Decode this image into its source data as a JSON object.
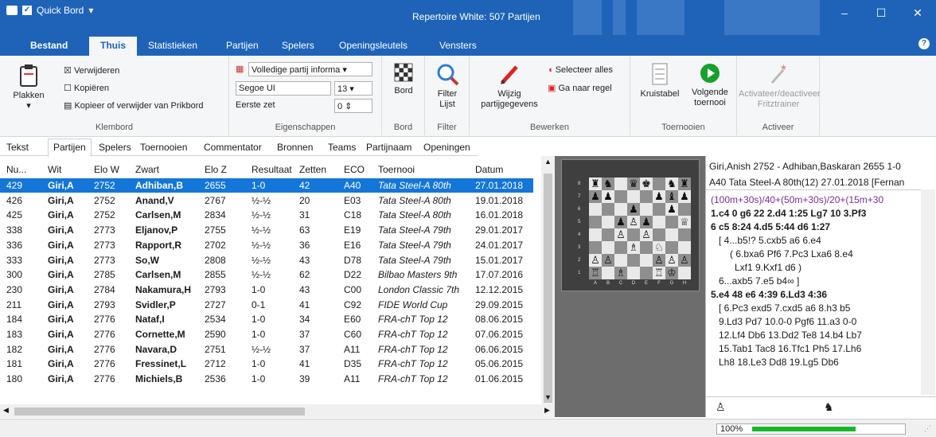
{
  "qat": {
    "app_label": "Quick Bord"
  },
  "window": {
    "title": "Repertoire White: 507 Partijen"
  },
  "menu": {
    "tabs": [
      "Bestand",
      "Thuis",
      "Statistieken",
      "Partijen",
      "Spelers",
      "Openingsleutels",
      "Vensters"
    ],
    "active": "Thuis"
  },
  "ribbon": {
    "klembord": {
      "paste": "Plakken",
      "delete": "Verwijderen",
      "copy": "Kopiëren",
      "copydel": "Kopieer of verwijder van Prikbord",
      "label": "Klembord"
    },
    "eigenschappen": {
      "mode": "Volledige partij informa",
      "font": "Segoe UI",
      "size": "13",
      "first": "Eerste zet",
      "firstval": "0",
      "label": "Eigenschappen"
    },
    "bord": {
      "btn": "Bord",
      "label": "Bord"
    },
    "filter": {
      "btn1": "Filter",
      "btn2": "Lijst",
      "label": "Filter"
    },
    "bewerken": {
      "edit1": "Wijzig",
      "edit2": "partijgegevens",
      "selectall": "Selecteer alles",
      "goto": "Ga naar regel",
      "label": "Bewerken"
    },
    "toernooien": {
      "kruis": "Kruistabel",
      "next1": "Volgende",
      "next2": "toernooi",
      "label": "Toernooien"
    },
    "activeer": {
      "btn1": "Activateer/deactiveer",
      "btn2": "Fritztrainer",
      "label": "Activeer"
    }
  },
  "subtabs": [
    "Tekst",
    "Partijen",
    "Spelers",
    "Toernooien",
    "Commentator",
    "Bronnen",
    "Teams",
    "Partijnaam",
    "Openingen"
  ],
  "columns": [
    "Nu...",
    "Wit",
    "Elo W",
    "Zwart",
    "Elo Z",
    "Resultaat",
    "Zetten",
    "ECO",
    "Toernooi",
    "Datum"
  ],
  "rows": [
    [
      "429",
      "Giri,A",
      "2752",
      "Adhiban,B",
      "2655",
      "1-0",
      "42",
      "A40",
      "Tata Steel-A 80th",
      "27.01.2018"
    ],
    [
      "426",
      "Giri,A",
      "2752",
      "Anand,V",
      "2767",
      "½-½",
      "20",
      "E03",
      "Tata Steel-A 80th",
      "19.01.2018"
    ],
    [
      "425",
      "Giri,A",
      "2752",
      "Carlsen,M",
      "2834",
      "½-½",
      "31",
      "C18",
      "Tata Steel-A 80th",
      "16.01.2018"
    ],
    [
      "338",
      "Giri,A",
      "2773",
      "Eljanov,P",
      "2755",
      "½-½",
      "63",
      "E19",
      "Tata Steel-A 79th",
      "29.01.2017"
    ],
    [
      "336",
      "Giri,A",
      "2773",
      "Rapport,R",
      "2702",
      "½-½",
      "36",
      "E16",
      "Tata Steel-A 79th",
      "24.01.2017"
    ],
    [
      "333",
      "Giri,A",
      "2773",
      "So,W",
      "2808",
      "½-½",
      "43",
      "D78",
      "Tata Steel-A 79th",
      "15.01.2017"
    ],
    [
      "300",
      "Giri,A",
      "2785",
      "Carlsen,M",
      "2855",
      "½-½",
      "62",
      "D22",
      "Bilbao Masters 9th",
      "17.07.2016"
    ],
    [
      "230",
      "Giri,A",
      "2784",
      "Nakamura,H",
      "2793",
      "1-0",
      "43",
      "C00",
      "London Classic 7th",
      "12.12.2015"
    ],
    [
      "211",
      "Giri,A",
      "2793",
      "Svidler,P",
      "2727",
      "0-1",
      "41",
      "C92",
      "FIDE World Cup",
      "29.09.2015"
    ],
    [
      "184",
      "Giri,A",
      "2776",
      "Nataf,I",
      "2534",
      "1-0",
      "34",
      "E60",
      "FRA-chT Top 12",
      "08.06.2015"
    ],
    [
      "183",
      "Giri,A",
      "2776",
      "Cornette,M",
      "2590",
      "1-0",
      "37",
      "C60",
      "FRA-chT Top 12",
      "07.06.2015"
    ],
    [
      "182",
      "Giri,A",
      "2776",
      "Navara,D",
      "2751",
      "½-½",
      "37",
      "A11",
      "FRA-chT Top 12",
      "06.06.2015"
    ],
    [
      "181",
      "Giri,A",
      "2776",
      "Fressinet,L",
      "2712",
      "1-0",
      "41",
      "D35",
      "FRA-chT Top 12",
      "05.06.2015"
    ],
    [
      "180",
      "Giri,A",
      "2776",
      "Michiels,B",
      "2536",
      "1-0",
      "39",
      "A11",
      "FRA-chT Top 12",
      "01.06.2015"
    ]
  ],
  "notation": {
    "head1": "Giri,Anish 2752 - Adhiban,Baskaran 2655 1-0",
    "head2": "A40 Tata Steel-A 80th(12) 27.01.2018 [Fernan",
    "lines": [
      "(100m+30s)/40+(50m+30s)/20+(15m+30",
      "1.c4 0 g6 22 2.d4 1:25 Lg7 10 3.Pf3",
      "6 c5 8:24 4.d5 5:44 d6 1:27",
      "[ 4...b5!? 5.cxb5 a6 6.e4",
      "( 6.bxa6 Pf6 7.Pc3 Lxa6 8.e4",
      "Lxf1 9.Kxf1 d6 )",
      "6...axb5 7.e5 b4∞ ]",
      "5.e4 48 e6 4:39 6.Ld3 4:36",
      "[ 6.Pc3 exd5 7.cxd5 a6 8.h3 b5",
      "9.Ld3 Pd7 10.0-0 Pgf6 11.a3 0-0",
      "12.Lf4 Db6 13.Dd2 Te8 14.b4 Lb7",
      "15.Tab1 Tac8 16.Tfc1 Ph5 17.Lh6",
      "Lh8 18.Le3 Dd8 19.Lg5 Db6"
    ]
  },
  "board": {
    "ranks": [
      "8",
      "7",
      "6",
      "5",
      "4",
      "3",
      "2",
      "1"
    ],
    "files": [
      "A",
      "B",
      "C",
      "D",
      "E",
      "F",
      "G",
      "H"
    ],
    "squares": [
      "♜",
      "♞",
      "",
      "♛",
      "♚",
      "",
      "♞",
      "♜",
      "♟",
      "♟",
      "",
      "",
      "",
      "♟",
      "♝",
      "♟",
      "",
      "",
      "",
      "♟",
      "",
      "",
      "♟",
      "",
      "",
      "",
      "♟",
      "♙",
      "♟",
      "",
      "",
      "♕",
      "",
      "",
      "♙",
      "",
      "♙",
      "",
      "",
      "",
      "",
      "",
      "",
      "♗",
      "",
      "♘",
      "",
      "",
      "♙",
      "♙",
      "",
      "",
      "",
      "♙",
      "♙",
      "♙",
      "♖",
      "",
      "♗",
      "",
      "",
      "♖",
      "♔",
      ""
    ]
  },
  "status": {
    "zoom": "100%"
  },
  "colors": {
    "titlebar": "#1e63b8",
    "selection": "#1376d8",
    "time": "#7a2a9a",
    "zoombar": "#16b829"
  }
}
